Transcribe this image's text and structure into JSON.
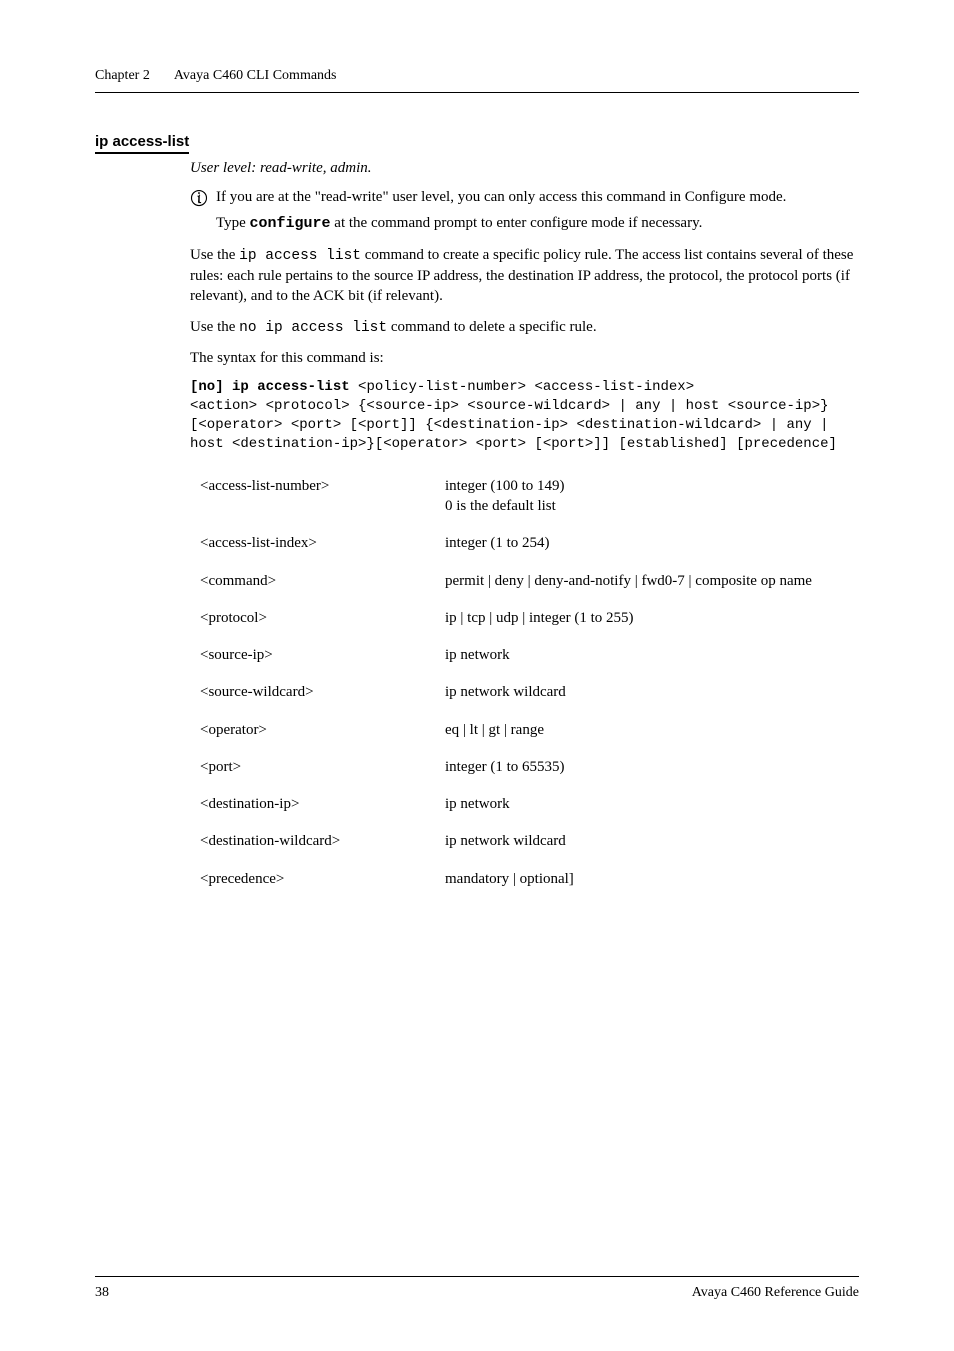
{
  "header": {
    "chapter_label": "Chapter 2",
    "chapter_title": "Avaya C460 CLI Commands"
  },
  "section_title": "ip access-list",
  "user_level": "User level: read-write, admin.",
  "note_text": "If you are at the \"read-write\" user level, you can only access this command in Configure mode.",
  "note_sub_prefix": "Type ",
  "note_sub_cmd": "configure",
  "note_sub_suffix": " at the command prompt to enter configure mode if necessary.",
  "para1_prefix": "Use the ",
  "para1_cmd": "ip access list",
  "para1_suffix": " command to create a specific policy rule. The access list contains several of these rules: each rule pertains to the source IP address, the destination IP address, the protocol, the protocol ports (if relevant), and to the ACK bit (if relevant).",
  "para2_prefix": "Use the ",
  "para2_cmd": "no ip access list",
  "para2_suffix": " command to delete a specific rule.",
  "syntax_label": "The syntax for this command is:",
  "syntax_bold": "[no] ip access-list",
  "syntax_rest1": " <policy-list-number> <access-list-index>",
  "syntax_rest2": "<action> <protocol> {<source-ip> <source-wildcard> | any | host <source-ip>}[<operator> <port> [<port]] {<destination-ip> <destination-wildcard> | any | host <destination-ip>}[<operator> <port> [<port>]] [established] [precedence]",
  "params": [
    {
      "name": "<access-list-number>",
      "desc": "integer (100 to 149)\n0 is the default list"
    },
    {
      "name": "<access-list-index>",
      "desc": "integer (1 to 254)"
    },
    {
      "name": "<command>",
      "desc": "permit | deny | deny-and-notify | fwd0-7 | composite op name"
    },
    {
      "name": "<protocol>",
      "desc": "ip | tcp | udp | integer (1 to 255)"
    },
    {
      "name": "<source-ip>",
      "desc": "ip network"
    },
    {
      "name": "<source-wildcard>",
      "desc": "ip network wildcard"
    },
    {
      "name": "<operator>",
      "desc": "eq | lt | gt | range"
    },
    {
      "name": "<port>",
      "desc": "integer (1 to 65535)"
    },
    {
      "name": "<destination-ip>",
      "desc": "ip network"
    },
    {
      "name": "<destination-wildcard>",
      "desc": "ip network wildcard"
    },
    {
      "name": "<precedence>",
      "desc": "mandatory | optional]"
    }
  ],
  "footer": {
    "page": "38",
    "doc": "Avaya C460 Reference Guide"
  }
}
